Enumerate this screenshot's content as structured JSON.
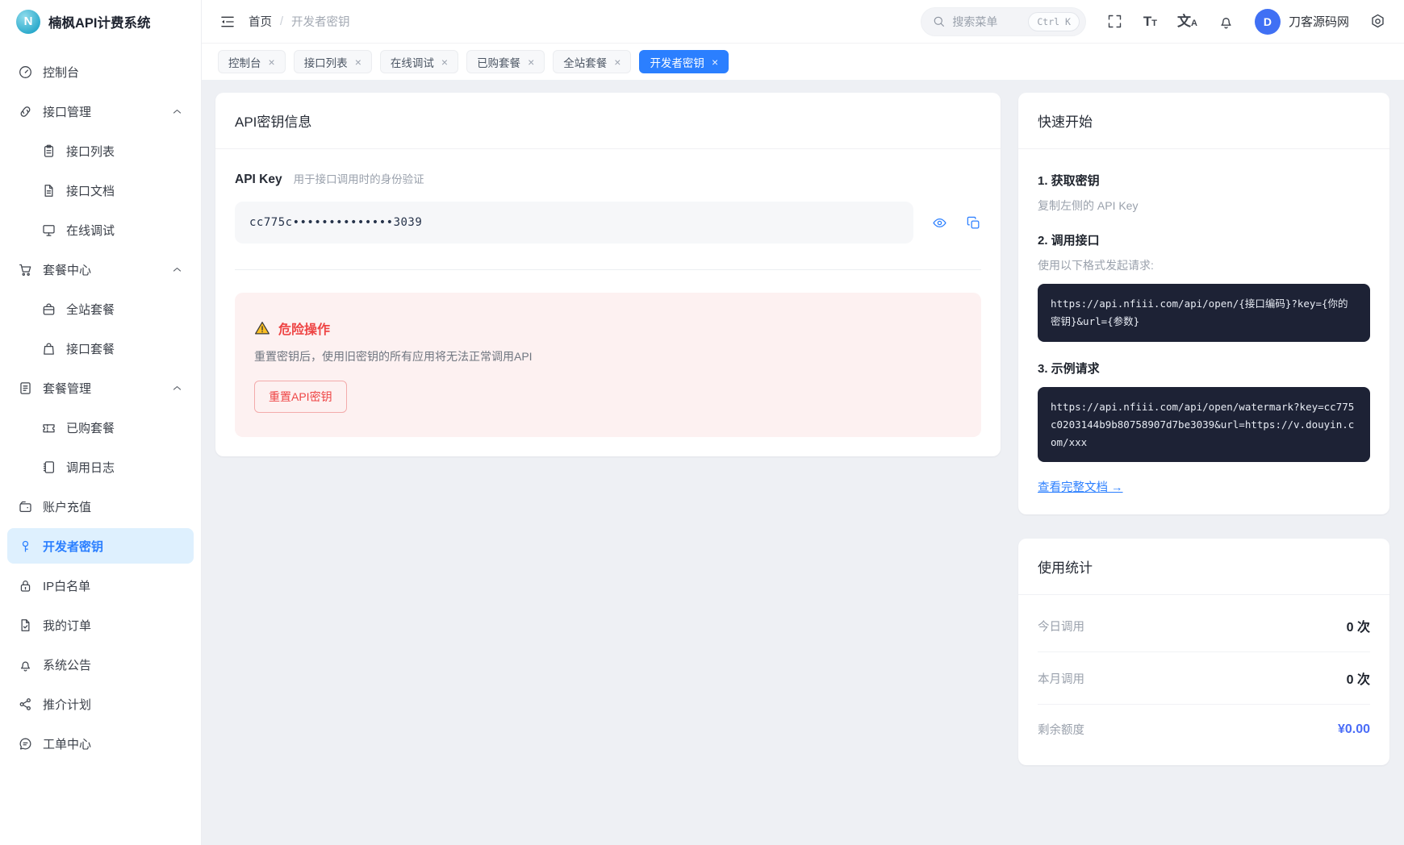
{
  "app": {
    "title": "楠枫API计费系统",
    "logo_letter": "N"
  },
  "header": {
    "breadcrumb": {
      "home": "首页",
      "separator": "/",
      "current": "开发者密钥"
    },
    "search": {
      "placeholder": "搜索菜单",
      "shortcut": "Ctrl K"
    },
    "user": {
      "initial": "D",
      "name": "刀客源码网"
    }
  },
  "tabs": [
    {
      "label": "控制台",
      "close": "×",
      "active": false
    },
    {
      "label": "接口列表",
      "close": "×",
      "active": false
    },
    {
      "label": "在线调试",
      "close": "×",
      "active": false
    },
    {
      "label": "已购套餐",
      "close": "×",
      "active": false
    },
    {
      "label": "全站套餐",
      "close": "×",
      "active": false
    },
    {
      "label": "开发者密钥",
      "close": "×",
      "active": true
    }
  ],
  "sidebar": {
    "items": [
      {
        "label": "控制台",
        "icon": "gauge",
        "type": "item"
      },
      {
        "label": "接口管理",
        "icon": "link",
        "type": "group"
      },
      {
        "label": "接口列表",
        "icon": "clipboard",
        "type": "child"
      },
      {
        "label": "接口文档",
        "icon": "file",
        "type": "child"
      },
      {
        "label": "在线调试",
        "icon": "monitor",
        "type": "child"
      },
      {
        "label": "套餐中心",
        "icon": "cart",
        "type": "group"
      },
      {
        "label": "全站套餐",
        "icon": "briefcase",
        "type": "child"
      },
      {
        "label": "接口套餐",
        "icon": "bag",
        "type": "child"
      },
      {
        "label": "套餐管理",
        "icon": "doclist",
        "type": "group"
      },
      {
        "label": "已购套餐",
        "icon": "ticket",
        "type": "child"
      },
      {
        "label": "调用日志",
        "icon": "notebook",
        "type": "child"
      },
      {
        "label": "账户充值",
        "icon": "wallet",
        "type": "item"
      },
      {
        "label": "开发者密钥",
        "icon": "key",
        "type": "item",
        "active": true
      },
      {
        "label": "IP白名单",
        "icon": "lock",
        "type": "item"
      },
      {
        "label": "我的订单",
        "icon": "order",
        "type": "item"
      },
      {
        "label": "系统公告",
        "icon": "bell",
        "type": "item"
      },
      {
        "label": "推介计划",
        "icon": "share",
        "type": "item"
      },
      {
        "label": "工单中心",
        "icon": "chat",
        "type": "item"
      }
    ]
  },
  "main": {
    "api_key_card": {
      "title": "API密钥信息",
      "key_label": "API Key",
      "key_desc": "用于接口调用时的身份验证",
      "key_value": "cc775c••••••••••••••3039",
      "danger": {
        "title": "危险操作",
        "desc": "重置密钥后，使用旧密钥的所有应用将无法正常调用API",
        "button": "重置API密钥"
      }
    }
  },
  "quick_start": {
    "title": "快速开始",
    "steps": [
      {
        "title": "1. 获取密钥",
        "desc": "复制左侧的 API Key"
      },
      {
        "title": "2. 调用接口",
        "desc": "使用以下格式发起请求:",
        "code": "https://api.nfiii.com/api/open/{接口编码}?key={你的密钥}&url={参数}"
      },
      {
        "title": "3. 示例请求",
        "code": "https://api.nfiii.com/api/open/watermark?key=cc775c0203144b9b80758907d7be3039&url=https://v.douyin.com/xxx"
      }
    ],
    "doc_link": "查看完整文档 →"
  },
  "usage_stats": {
    "title": "使用统计",
    "rows": [
      {
        "label": "今日调用",
        "value": "0 次"
      },
      {
        "label": "本月调用",
        "value": "0 次"
      },
      {
        "label": "剩余额度",
        "value": "¥0.00"
      }
    ]
  },
  "icons": {
    "logo": "n-badge",
    "header": [
      "collapse-icon",
      "search-icon",
      "fullscreen-icon",
      "font-size-icon",
      "translate-icon",
      "bell-icon",
      "gear-icon"
    ],
    "key_actions": [
      "eye-icon",
      "copy-icon"
    ],
    "danger": "warning-icon",
    "groups_chevron": "chevron-up-icon"
  },
  "colors": {
    "accent": "#2b7fff",
    "sidebar_active_bg": "#def0fe",
    "danger_text": "#ee4545",
    "danger_bg": "#fdf1f1",
    "code_bg": "#1d2235",
    "balance_accent": "#4a6cf7",
    "page_bg": "#eef0f4"
  }
}
